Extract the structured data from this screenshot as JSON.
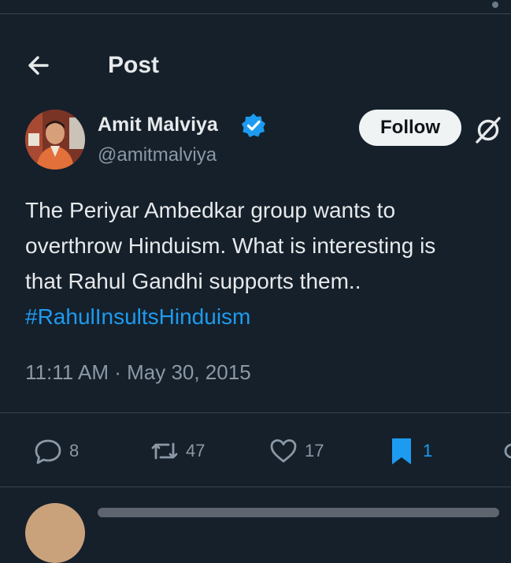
{
  "header": {
    "title": "Post"
  },
  "tweet": {
    "author_name": "Amit Malviya",
    "handle": "@amitmalviya",
    "follow_label": "Follow",
    "text_lines": [
      "The Periyar Ambedkar group wants to",
      "overthrow Hinduism. What is interesting is",
      "that Rahul Gandhi supports them.."
    ],
    "hashtag": "#RahulInsultsHinduism",
    "timestamp": "11:11 AM · May 30, 2015"
  },
  "actions": {
    "replies": "8",
    "reposts": "47",
    "likes": "17",
    "bookmarks": "1"
  },
  "icons": {
    "back": "arrow-left-icon",
    "verified": "verified-badge-icon",
    "grok": "grok-icon",
    "reply": "reply-icon",
    "repost": "repost-icon",
    "like": "heart-icon",
    "bookmark": "bookmark-icon",
    "share": "share-icon"
  },
  "colors": {
    "background": "#15202b",
    "accent": "#1d9bf0",
    "text_primary": "#e7e9ea",
    "text_secondary": "#8b98a5",
    "divider": "#38444d"
  }
}
